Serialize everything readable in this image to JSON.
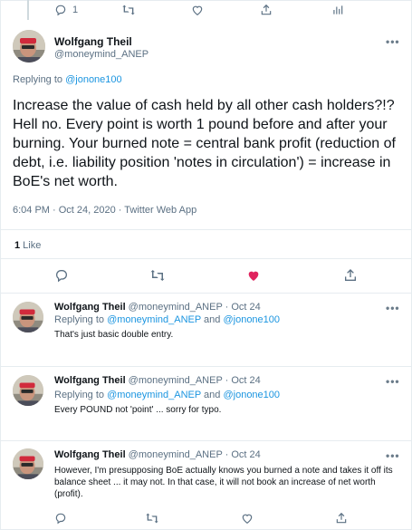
{
  "top_actions": {
    "reply_count": "1"
  },
  "main_tweet": {
    "name": "Wolfgang Theil",
    "handle": "@moneymind_ANEP",
    "replying_to_prefix": "Replying to ",
    "replying_to_handle": "@jonone100",
    "text": "Increase the value of cash held by all other cash holders?!? Hell no.  Every point is worth 1 pound before and after your burning. Your burned note = central bank profit (reduction of debt, i.e. liability position 'notes in circulation') = increase in BoE's net worth.",
    "timestamp": "6:04 PM · Oct 24, 2020 · Twitter Web App",
    "like_count": "1",
    "like_label": " Like"
  },
  "replies": [
    {
      "name": "Wolfgang Theil",
      "handle_time": " @moneymind_ANEP · Oct 24",
      "replying_prefix": "Replying to ",
      "replying_handle1": "@moneymind_ANEP",
      "replying_and": " and ",
      "replying_handle2": "@jonone100",
      "text": "That's just basic double entry."
    },
    {
      "name": "Wolfgang Theil",
      "handle_time": " @moneymind_ANEP · Oct 24",
      "replying_prefix": "Replying to ",
      "replying_handle1": "@moneymind_ANEP",
      "replying_and": " and ",
      "replying_handle2": "@jonone100",
      "text": "Every POUND not 'point' ... sorry for typo."
    },
    {
      "name": "Wolfgang Theil",
      "handle_time": " @moneymind_ANEP · Oct 24",
      "text": "However, I'm presupposing BoE actually knows you burned a note and takes it off its balance sheet ... it may not.  In that case, it will not book an increase of net worth (profit)."
    }
  ],
  "colors": {
    "accent": "#1b95e0",
    "like": "#e0245e",
    "muted": "#5b7083"
  }
}
